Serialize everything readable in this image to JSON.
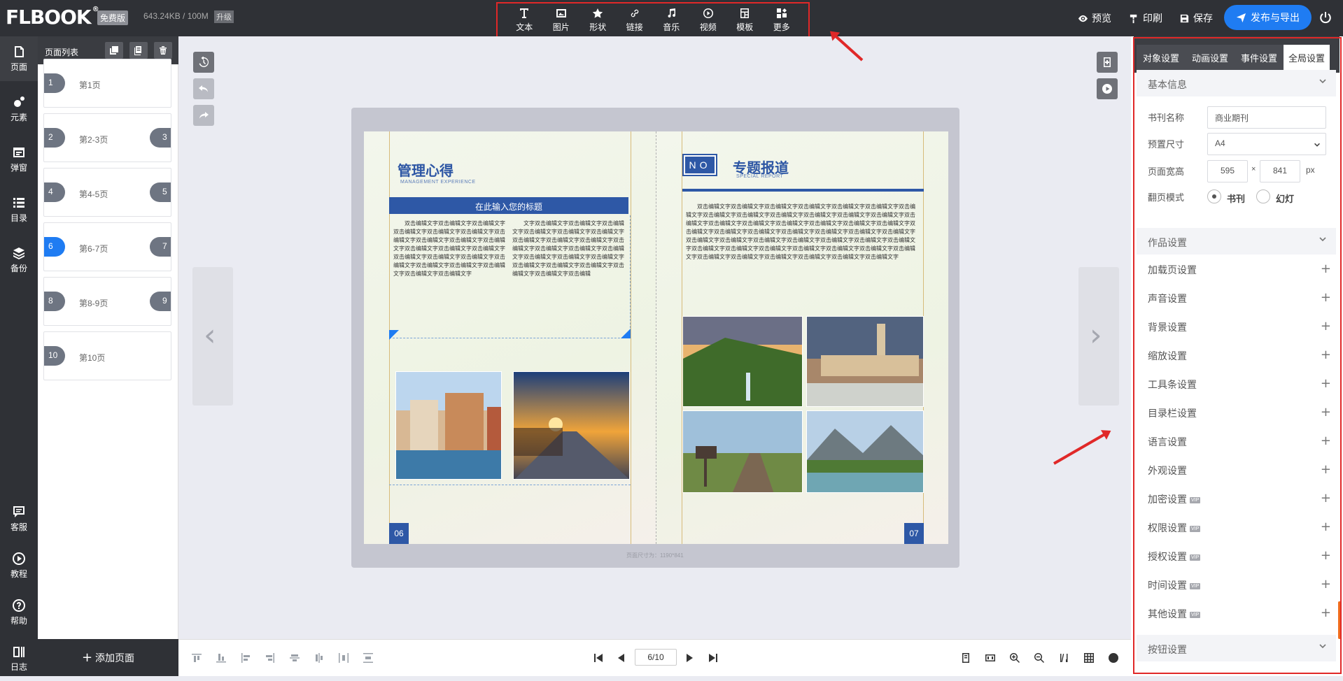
{
  "app": {
    "logo": "FLBOOK",
    "badge": "免费版",
    "storage": "643.24KB / 100M",
    "upgrade": "升级"
  },
  "tools": [
    {
      "label": "文本",
      "icon": "text-icon"
    },
    {
      "label": "图片",
      "icon": "image-icon"
    },
    {
      "label": "形状",
      "icon": "star-icon"
    },
    {
      "label": "链接",
      "icon": "link-icon"
    },
    {
      "label": "音乐",
      "icon": "music-icon"
    },
    {
      "label": "视频",
      "icon": "play-icon"
    },
    {
      "label": "模板",
      "icon": "template-icon"
    },
    {
      "label": "更多",
      "icon": "more-icon"
    }
  ],
  "actions": {
    "preview": "预览",
    "print": "印刷",
    "save": "保存",
    "publish": "发布与导出"
  },
  "leftnav": [
    {
      "label": "页面",
      "icon": "page-icon"
    },
    {
      "label": "元素",
      "icon": "elements-icon"
    },
    {
      "label": "弹窗",
      "icon": "popup-icon"
    },
    {
      "label": "目录",
      "icon": "list-icon"
    },
    {
      "label": "备份",
      "icon": "layers-icon"
    },
    {
      "label": "客服",
      "icon": "chat-icon"
    },
    {
      "label": "教程",
      "icon": "play-circle-icon"
    },
    {
      "label": "帮助",
      "icon": "help-icon"
    },
    {
      "label": "日志",
      "icon": "log-icon"
    }
  ],
  "pagelist": {
    "title": "页面列表",
    "pages": [
      {
        "n": "1",
        "n2": "",
        "label": "第1页"
      },
      {
        "n": "2",
        "n2": "3",
        "label": "第2-3页"
      },
      {
        "n": "4",
        "n2": "5",
        "label": "第4-5页"
      },
      {
        "n": "6",
        "n2": "7",
        "label": "第6-7页"
      },
      {
        "n": "8",
        "n2": "9",
        "label": "第8-9页"
      },
      {
        "n": "10",
        "n2": "",
        "label": "第10页"
      }
    ],
    "add": "添加页面"
  },
  "book": {
    "left_title": "管理心得",
    "left_sub": "MANAGEMENT EXPERIENCE",
    "left_bar": "在此输入您的标题",
    "left_num": "06",
    "right_no": "NO",
    "right_title": "专题报道",
    "right_sub": "SPECIAL REPORT",
    "right_num": "07",
    "body_a": "双击编辑文字双击编辑文字双击编辑文字双击编辑文字双击编辑文字双击编辑文字双击编辑文字双击编辑文字双击编辑文字双击编辑文字双击编辑文字双击编辑文字双击编辑文字双击编辑文字双击编辑文字双击编辑文字双击编辑文字双击编辑文字双击编辑文字双击编辑文字双击编辑文字双击编辑文字",
    "body_b": "文字双击编辑文字双击编辑文字双击编辑文字双击编辑文字双击编辑文字双击编辑文字双击编辑文字双击编辑文字双击编辑文字双击编辑文字双击编辑文字双击编辑文字双击编辑文字双击编辑文字双击编辑文字双击编辑文字双击编辑文字双击编辑文字双击编辑文字双击编辑文字双击编辑文字双击编辑",
    "body_r": "双击编辑文字双击编辑文字双击编辑文字双击编辑文字双击编辑文字双击编辑文字双击编辑文字双击编辑文字双击编辑文字双击编辑文字双击编辑文字双击编辑文字双击编辑文字双击编辑文字双击编辑文字双击编辑文字双击编辑文字双击编辑文字双击编辑文字双击编辑文字双击编辑文字双击编辑文字双击编辑文字双击编辑文字双击编辑文字双击编辑文字双击编辑文字双击编辑文字双击编辑文字双击编辑文字双击编辑文字双击编辑文字双击编辑文字双击编辑文字双击编辑文字双击编辑文字双击编辑文字双击编辑文字双击编辑文字双击编辑文字双击编辑文字双击编辑文字双击编辑文字双击编辑文字双击编辑文字双击编辑文字双击编辑文字",
    "size_text": "页面尺寸为：1190*841"
  },
  "pager": {
    "current": "6/10"
  },
  "tabs": [
    "对象设置",
    "动画设置",
    "事件设置",
    "全局设置"
  ],
  "basic": {
    "section": "基本信息",
    "name_label": "书刊名称",
    "name_value": "商业期刊",
    "size_label": "预置尺寸",
    "size_value": "A4",
    "wh_label": "页面宽高",
    "width": "595",
    "x": "×",
    "height": "841",
    "unit": "px",
    "mode_label": "翻页模式",
    "mode_book": "书刊",
    "mode_slide": "幻灯"
  },
  "work": {
    "section": "作品设置",
    "items": [
      {
        "label": "加载页设置",
        "vip": ""
      },
      {
        "label": "声音设置",
        "vip": ""
      },
      {
        "label": "背景设置",
        "vip": ""
      },
      {
        "label": "缩放设置",
        "vip": ""
      },
      {
        "label": "工具条设置",
        "vip": ""
      },
      {
        "label": "目录栏设置",
        "vip": ""
      },
      {
        "label": "语言设置",
        "vip": ""
      },
      {
        "label": "外观设置",
        "vip": ""
      },
      {
        "label": "加密设置",
        "vip": "VIP"
      },
      {
        "label": "权限设置",
        "vip": "VIP"
      },
      {
        "label": "授权设置",
        "vip": "VIP"
      },
      {
        "label": "时间设置",
        "vip": "VIP"
      },
      {
        "label": "其他设置",
        "vip": "VIP"
      }
    ]
  },
  "button_section": "按钮设置",
  "colors": {
    "accent": "#1f7cf2",
    "annotation": "#e02828",
    "brand_blue": "#2e58a6"
  }
}
